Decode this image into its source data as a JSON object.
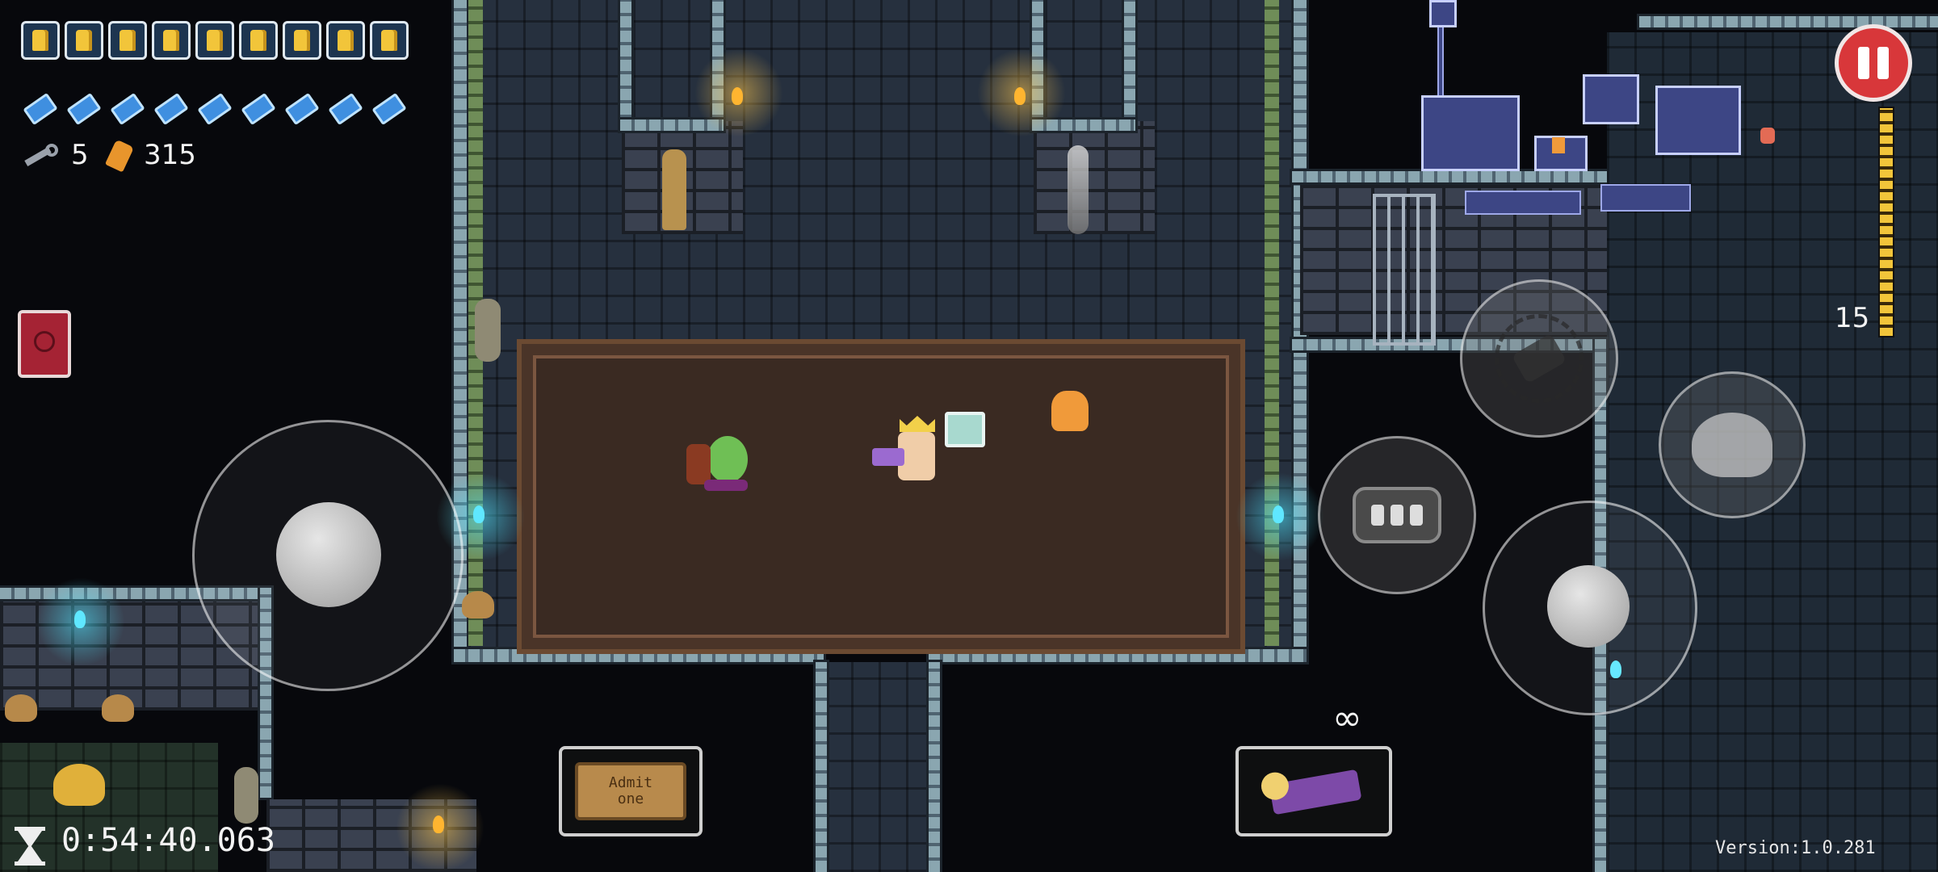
{
  "hud": {
    "hearts_full": 9,
    "blanks": 9,
    "keys": "5",
    "currency": "315",
    "ammo_count": "15",
    "ammo_infinite": "∞",
    "timer": "0:54:40.063",
    "version": "Version:1.0.281"
  },
  "item_active_label": "Admit one",
  "icons": {
    "pause": "pause-icon",
    "chat": "chat-icon",
    "dodge_roll": "dodge-roll-icon",
    "blank_action": "blank-action-icon",
    "key": "key-icon",
    "shell": "shell-currency-icon",
    "timer": "hourglass-icon",
    "passive_item": "red-book-icon"
  },
  "colors": {
    "heart": "#f2c53a",
    "blank": "#3f8fe0",
    "pause_button": "#d8373a",
    "minimap_room": "#3d4685",
    "ammo_bar": "#f2c53a"
  }
}
